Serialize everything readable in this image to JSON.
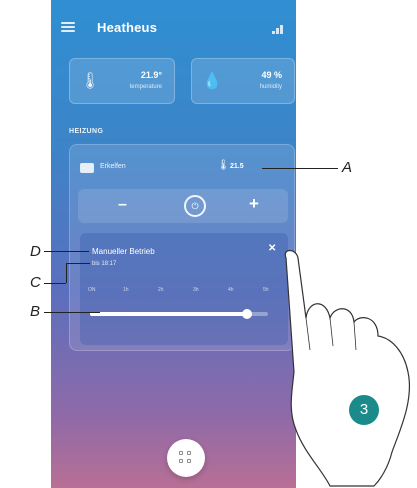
{
  "header": {
    "title": "Heatheus",
    "menu_icon": "hamburger-menu-icon",
    "signal_icon": "signal-icon"
  },
  "sensors": [
    {
      "icon": "thermometer-icon",
      "value": "21.9°",
      "label": "temperature"
    },
    {
      "icon": "humidity-drop-icon",
      "value": "49 %",
      "label": "humidity"
    }
  ],
  "section": {
    "label": "HEIZUNG"
  },
  "zone": {
    "name": "Erkelfen",
    "temperature": "21.5"
  },
  "controls": {
    "minus_label": "–",
    "mode_icon": "mode-circle-icon",
    "plus_label": "+"
  },
  "mode_panel": {
    "title": "Manueller Betrieb",
    "time": "bis 18:17",
    "close_label": "✕",
    "ticks": [
      "ON",
      "1h",
      "2h",
      "3h",
      "4h",
      "5h"
    ],
    "slider_level": 0.88
  },
  "fab": {
    "icon": "grid-apps-icon"
  },
  "callouts": {
    "a": "A",
    "b": "B",
    "c": "C",
    "d": "D",
    "step": "3"
  },
  "colors": {
    "callout_badge": "#1a8a8a",
    "gradient_top": "#2f8fd2",
    "gradient_bottom": "#b86f95"
  }
}
